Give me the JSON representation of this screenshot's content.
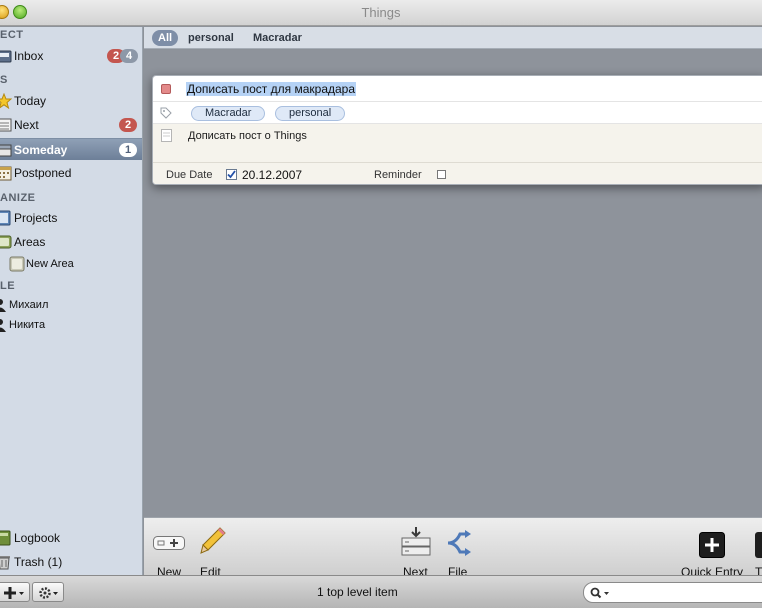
{
  "window": {
    "title": "Things"
  },
  "sidebar": {
    "sections": {
      "collect": "ECT",
      "focus": "S",
      "organize": "ANIZE",
      "people": "LE"
    },
    "items": {
      "inbox": {
        "label": "Inbox",
        "badge_red": "2",
        "badge_gray": "4"
      },
      "today": {
        "label": "Today"
      },
      "next": {
        "label": "Next",
        "badge_red": "2"
      },
      "someday": {
        "label": "Someday",
        "badge": "1"
      },
      "postponed": {
        "label": "Postponed"
      },
      "projects": {
        "label": "Projects"
      },
      "areas": {
        "label": "Areas"
      },
      "new_area": {
        "label": "New Area"
      },
      "person1": {
        "label": "Михаил"
      },
      "person2": {
        "label": "Никита"
      },
      "logbook": {
        "label": "Logbook"
      },
      "trash": {
        "label": "Trash (1)"
      }
    }
  },
  "filters": {
    "all": "All",
    "personal": "personal",
    "macradar": "Macradar"
  },
  "todo": {
    "title": "Дописать пост для макрадара",
    "tags": [
      "Macradar",
      "personal"
    ],
    "note": "Дописать пост о Things",
    "due_date_label": "Due Date",
    "due_date_value": "20.12.2007",
    "due_date_checked": true,
    "reminder_label": "Reminder",
    "reminder_checked": false
  },
  "toolbar": {
    "new_label": "New",
    "edit_label": "Edit",
    "next_label": "Next",
    "file_label": "File",
    "quick_entry_label": "Quick Entry",
    "cut_label": "T"
  },
  "statusbar": {
    "status": "1 top level item",
    "search_placeholder": ""
  },
  "colors": {
    "selection": "#7d8ea7",
    "badge_red": "#c4564f",
    "sidebar_bg": "#d3dbe6"
  }
}
